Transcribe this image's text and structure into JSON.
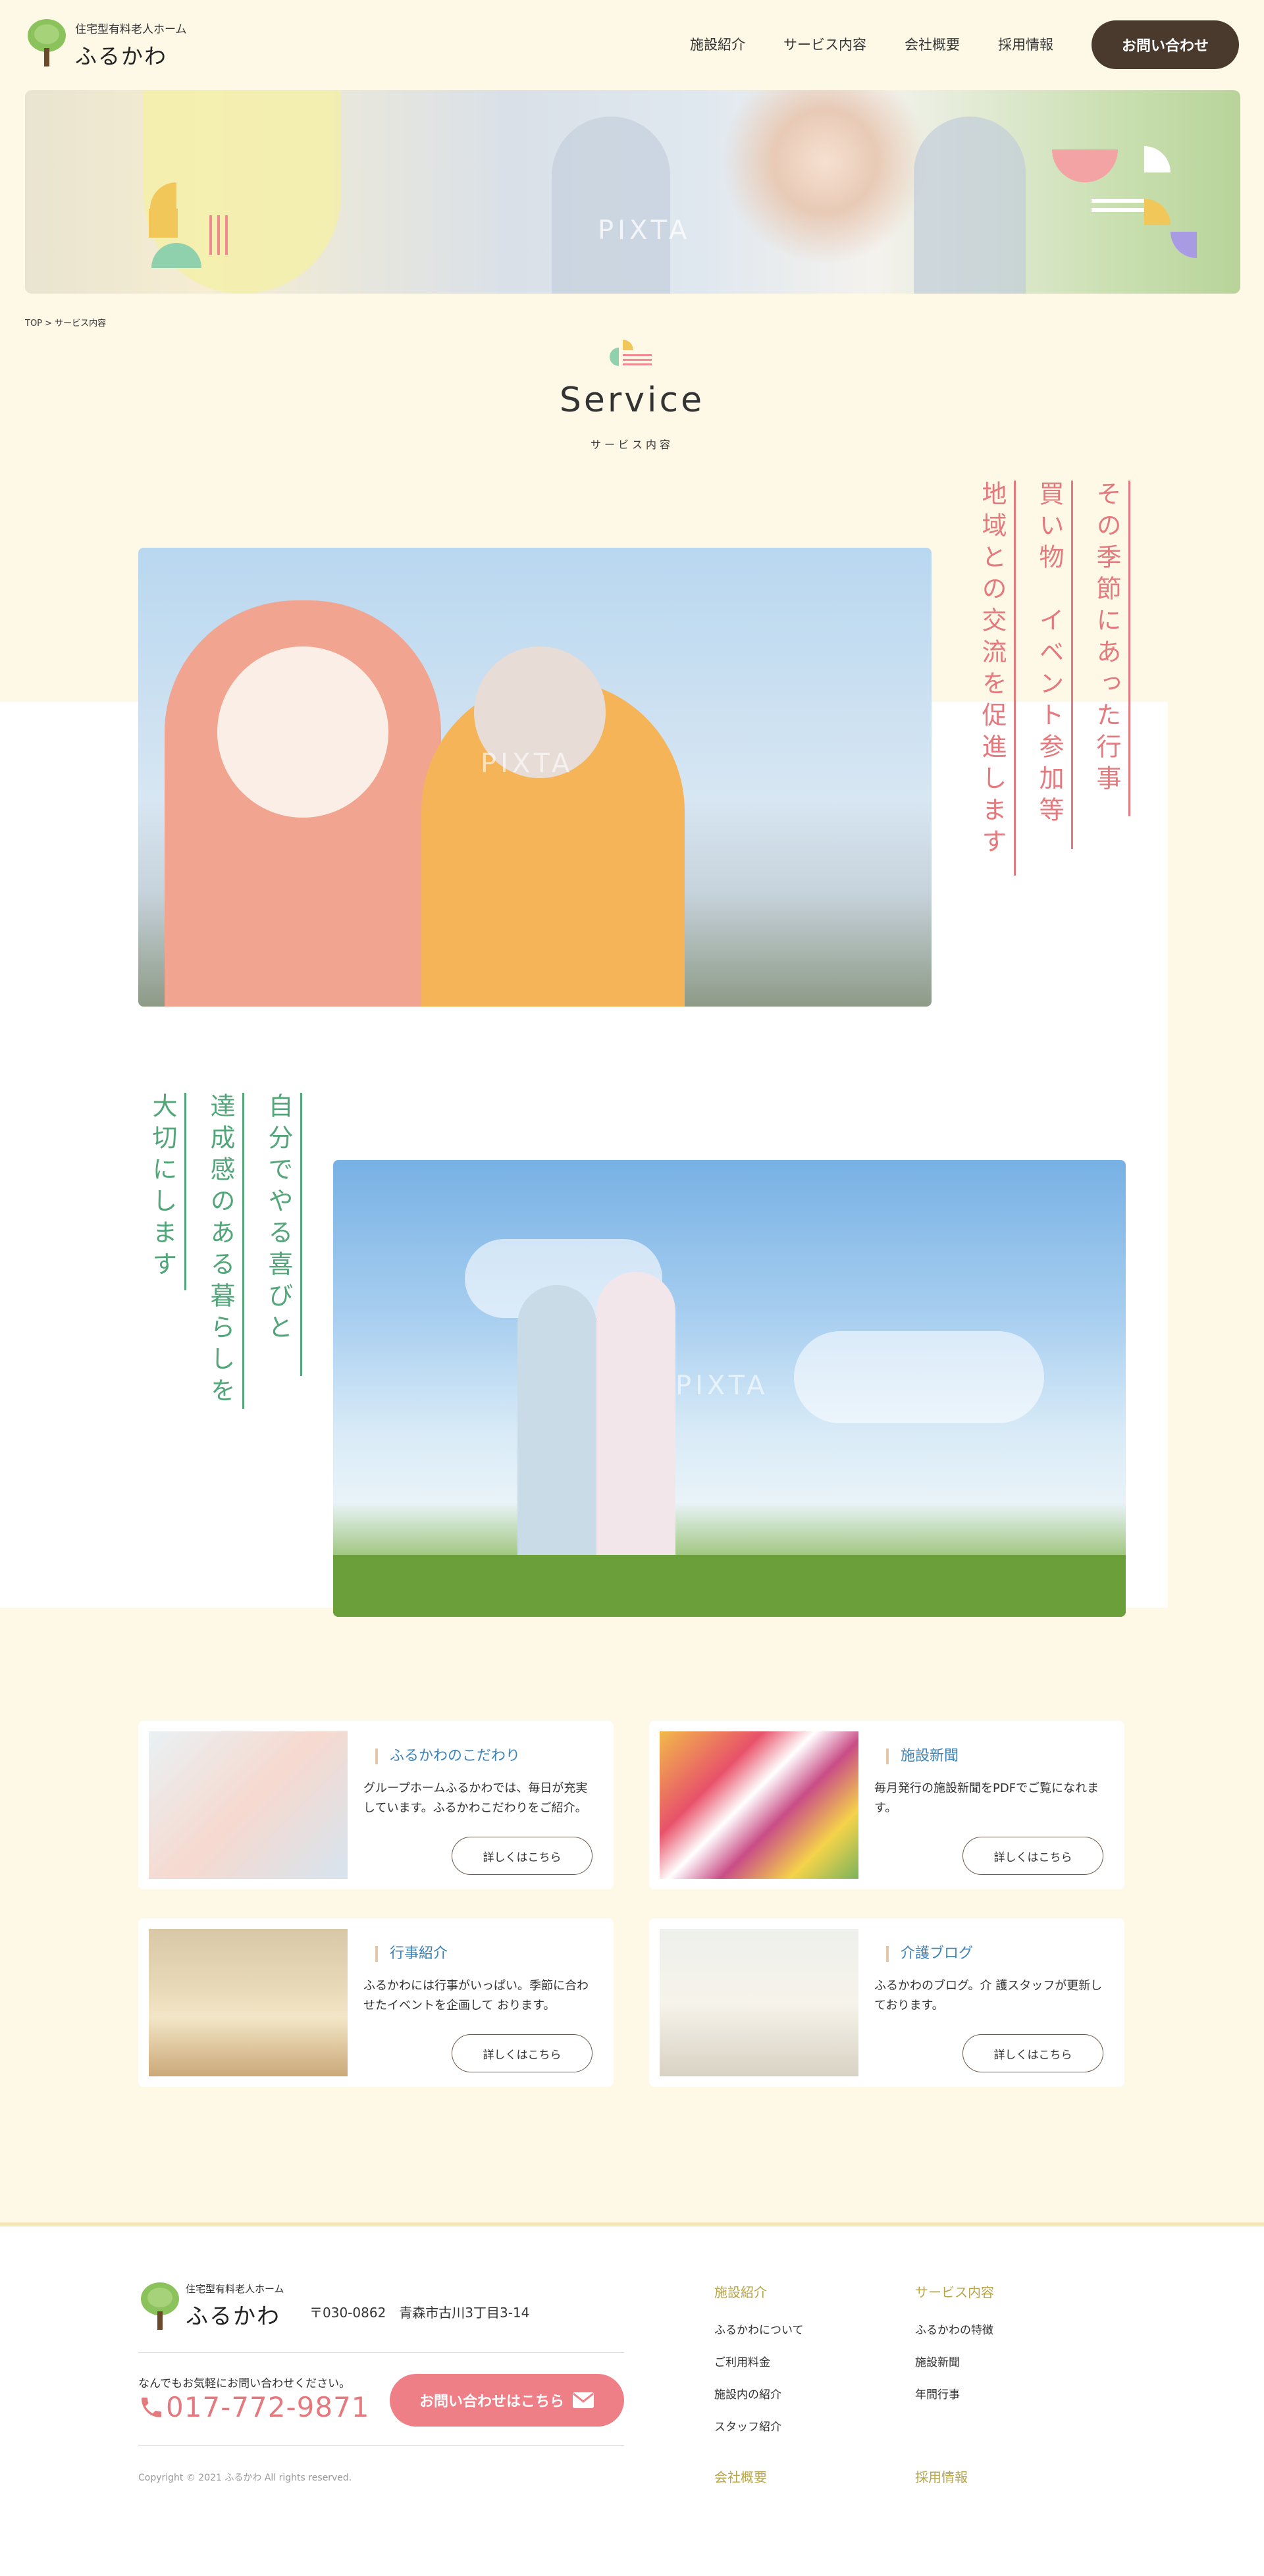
{
  "header": {
    "logo_sub": "住宅型有料老人ホーム",
    "logo_main": "ふるかわ",
    "nav": [
      "施設紹介",
      "サービス内容",
      "会社概要",
      "採用情報"
    ],
    "contact_label": "お問い合わせ"
  },
  "hero": {
    "watermark": "PIXTA"
  },
  "breadcrumb": "TOP > サービス内容",
  "section": {
    "title": "Service",
    "subtitle": "サービス内容"
  },
  "feature1": {
    "lines": [
      "その季節にあった行事",
      "買い物　イベント参加等",
      "地域との交流を促進します"
    ],
    "watermark": "PIXTA"
  },
  "feature2": {
    "lines": [
      "自分でやる喜びと",
      "達成感のある暮らしを",
      "大切にします"
    ],
    "watermark": "PIXTA"
  },
  "cards": [
    {
      "title": "ふるかわのこだわり",
      "desc": "グループホームふるかわでは、毎日が充実しています。ふるかわこだわりをご紹介。",
      "button": "詳しくはこちら"
    },
    {
      "title": "施設新聞",
      "desc": "毎月発行の施設新聞をPDFでご覧になれます。",
      "button": "詳しくはこちら"
    },
    {
      "title": "行事紹介",
      "desc": "ふるかわには行事がいっぱい。季節に合わせたイベントを企画して おります。",
      "button": "詳しくはこちら"
    },
    {
      "title": "介護ブログ",
      "desc": "ふるかわのブログ。介 護スタッフが更新しております。",
      "button": "詳しくはこちら"
    }
  ],
  "footer": {
    "logo_sub": "住宅型有料老人ホーム",
    "logo_main": "ふるかわ",
    "address": "〒030-0862　青森市古川3丁目3-14",
    "call_text": "なんでもお気軽にお問い合わせください。",
    "tel": "017-772-9871",
    "contact_label": "お問い合わせはこちら",
    "copyright": "Copyright © 2021 ふるかわ All rights reserved.",
    "col1": {
      "head": "施設紹介",
      "links": [
        "ふるかわについて",
        "ご利用料金",
        "施設内の紹介",
        "スタッフ紹介"
      ]
    },
    "col2": {
      "head": "サービス内容",
      "links": [
        "ふるかわの特徴",
        "施設新聞",
        "年間行事"
      ]
    },
    "col3": {
      "head": "会社概要"
    },
    "col4": {
      "head": "採用情報"
    }
  },
  "colors": {
    "accent_pink": "#e47a7e",
    "accent_green": "#53a67a",
    "brand_brown": "#4a3a2e",
    "bg_cream": "#fdf9e6",
    "link_blue": "#3d83b8"
  }
}
